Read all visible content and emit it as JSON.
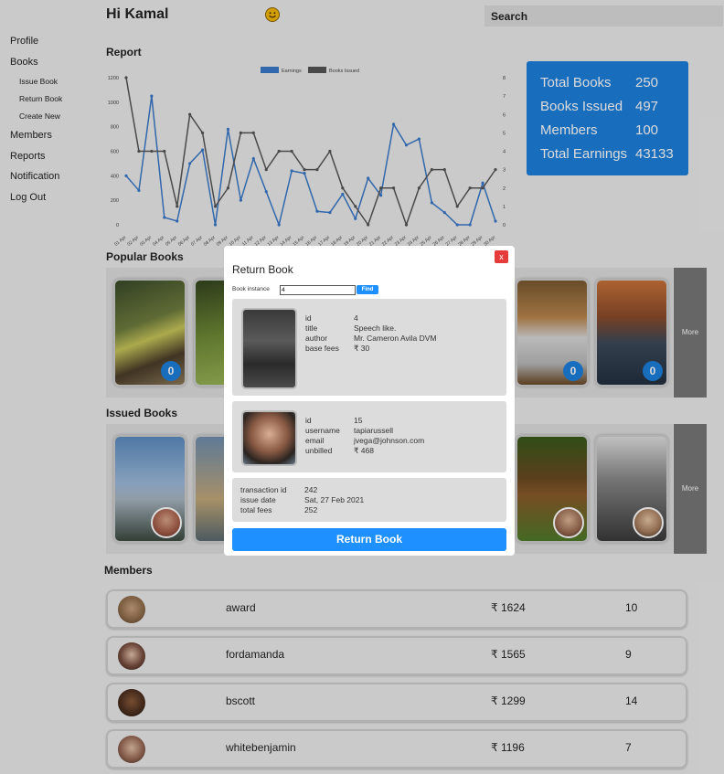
{
  "sidebar": {
    "items": [
      {
        "label": "Profile"
      },
      {
        "label": "Books"
      },
      {
        "label": "Issue Book"
      },
      {
        "label": "Return Book"
      },
      {
        "label": "Create New"
      },
      {
        "label": "Members"
      },
      {
        "label": "Reports"
      },
      {
        "label": "Notification"
      },
      {
        "label": "Log Out"
      }
    ]
  },
  "header": {
    "greeting": "Hi Kamal",
    "emoji_icon": "smiley-icon",
    "search_value": "Search"
  },
  "report": {
    "title": "Report"
  },
  "stats": {
    "total_books_label": "Total Books",
    "total_books": "250",
    "books_issued_label": "Books Issued",
    "books_issued": "497",
    "members_label": "Members",
    "members": "100",
    "total_earnings_label": "Total Earnings",
    "total_earnings": "43133",
    "color": "#1e7fdc"
  },
  "popular_books": {
    "title": "Popular Books",
    "badges": [
      "0",
      "0",
      "0"
    ],
    "more_label": "More"
  },
  "issued_books": {
    "title": "Issued Books",
    "more_label": "More"
  },
  "members_section": {
    "title": "Members",
    "rows": [
      {
        "name": "award",
        "amount": "₹ 1624",
        "count": "10"
      },
      {
        "name": "fordamanda",
        "amount": "₹ 1565",
        "count": "9"
      },
      {
        "name": "bscott",
        "amount": "₹ 1299",
        "count": "14"
      },
      {
        "name": "whitebenjamin",
        "amount": "₹ 1196",
        "count": "7"
      }
    ]
  },
  "modal": {
    "title": "Return Book",
    "close_label": "x",
    "instance_label": "Book instance",
    "instance_value": "4",
    "find_label": "Find",
    "book": {
      "id_label": "id",
      "id": "4",
      "title_label": "title",
      "title": "Speech like.",
      "author_label": "author",
      "author": "Mr. Cameron Avila DVM",
      "base_fees_label": "base fees",
      "base_fees": "₹ 30"
    },
    "member": {
      "id_label": "id",
      "id": "15",
      "username_label": "username",
      "username": "tapiarussell",
      "email_label": "email",
      "email": "jvega@johnson.com",
      "unbilled_label": "unbilled",
      "unbilled": "₹ 468"
    },
    "transaction": {
      "id_label": "transaction id",
      "id": "242",
      "date_label": "issue date",
      "date": "Sat, 27 Feb 2021",
      "fees_label": "total fees",
      "fees": "252"
    },
    "return_label": "Return Book",
    "accent": "#1e90ff"
  },
  "chart_data": {
    "type": "line",
    "categories": [
      "01 Apr",
      "02 Apr",
      "03 Apr",
      "04 Apr",
      "05 Apr",
      "06 Apr",
      "07 Apr",
      "08 Apr",
      "09 Apr",
      "10 Apr",
      "11 Apr",
      "12 Apr",
      "13 Apr",
      "14 Apr",
      "15 Apr",
      "16 Apr",
      "17 Apr",
      "18 Apr",
      "19 Apr",
      "20 Apr",
      "21 Apr",
      "22 Apr",
      "23 Apr",
      "24 Apr",
      "25 Apr",
      "26 Apr",
      "27 Apr",
      "28 Apr",
      "29 Apr",
      "30 Apr"
    ],
    "series": [
      {
        "name": "Earnings",
        "axis": "left",
        "color": "#3a78c9",
        "values": [
          400,
          280,
          1050,
          60,
          30,
          500,
          610,
          0,
          780,
          200,
          540,
          270,
          0,
          440,
          420,
          110,
          100,
          250,
          50,
          380,
          240,
          820,
          650,
          700,
          180,
          100,
          0,
          0,
          340,
          30
        ]
      },
      {
        "name": "Books Issued",
        "axis": "right",
        "color": "#555555",
        "values": [
          8,
          4,
          4,
          4,
          1,
          6,
          5,
          1,
          2,
          5,
          5,
          3,
          4,
          4,
          3,
          3,
          4,
          2,
          1,
          0,
          2,
          2,
          0,
          2,
          3,
          3,
          1,
          2,
          2,
          3
        ]
      }
    ],
    "left_ticks": [
      "0",
      "200",
      "400",
      "600",
      "800",
      "1000",
      "1200"
    ],
    "right_ticks": [
      "0",
      "1",
      "2",
      "3",
      "4",
      "5",
      "6",
      "7",
      "8"
    ],
    "ylim_left": [
      0,
      1200
    ],
    "ylim_right": [
      0,
      8
    ],
    "legend": "top-center"
  }
}
